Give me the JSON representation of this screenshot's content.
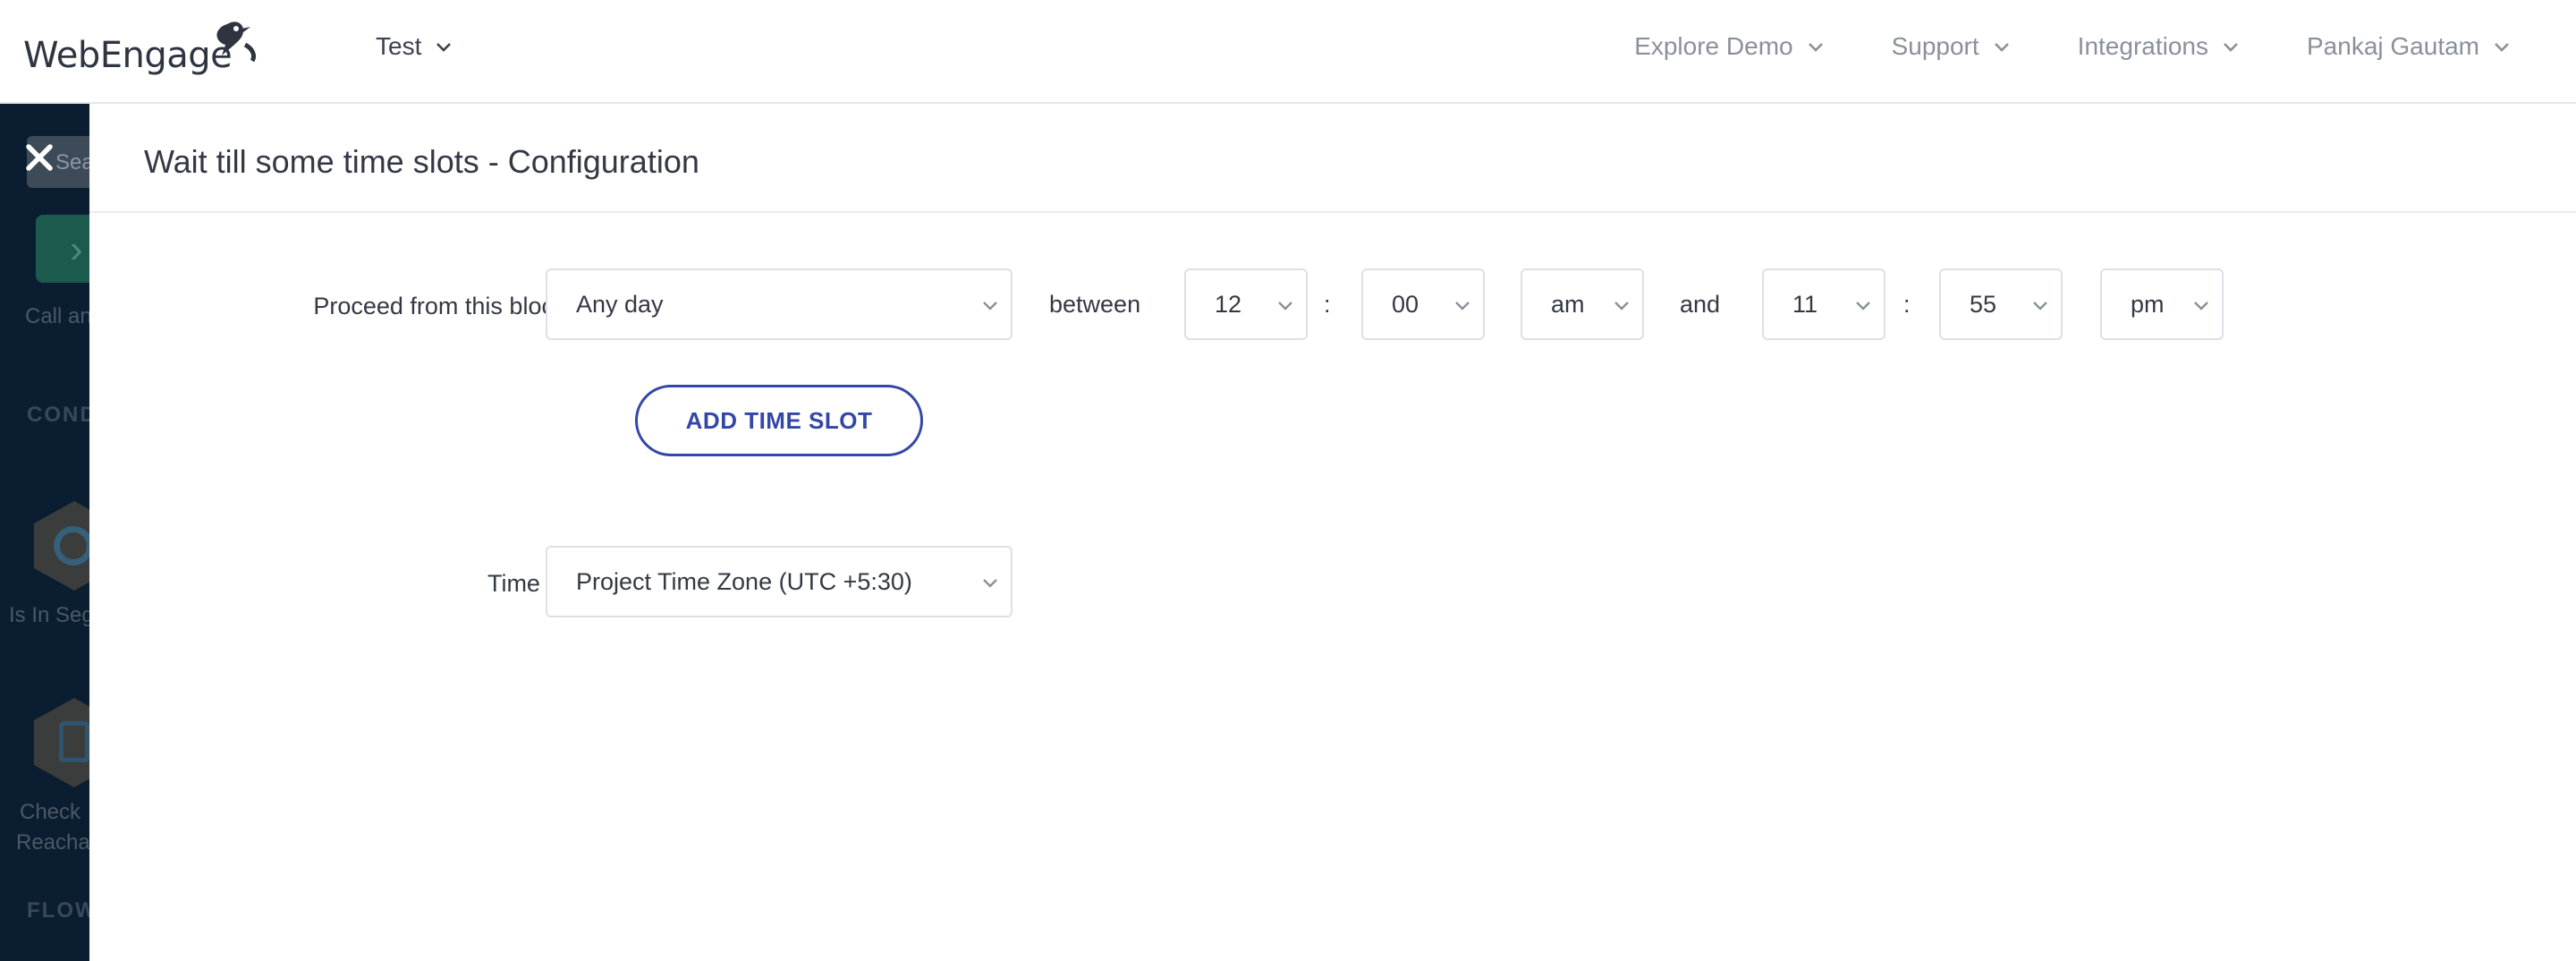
{
  "header": {
    "logo_text": "WebEngage",
    "project": "Test",
    "nav": [
      "Explore Demo",
      "Support",
      "Integrations",
      "Pankaj Gautam"
    ]
  },
  "sidebar": {
    "search_text": "Sear",
    "block_label": "Call an",
    "section_conditions": "COND",
    "item1": "Is In Seg",
    "item2_line1": "Check",
    "item2_line2": "Reacha",
    "section_flow": "FLOW"
  },
  "modal": {
    "title": "Wait till some time slots - Configuration",
    "proceed_label": "Proceed from this block on",
    "day": "Any day",
    "between": "between",
    "start_hour": "12",
    "start_minute": "00",
    "start_ampm": "am",
    "and": "and",
    "end_hour": "11",
    "end_minute": "55",
    "end_ampm": "pm",
    "colon": ":",
    "add_slot": "ADD TIME SLOT",
    "timezone_label": "Time zone",
    "timezone": "Project Time Zone (UTC +5:30)"
  },
  "colors": {
    "accent": "#3347a6",
    "sidebar_bg": "#0b1e31",
    "text": "#333844",
    "nav_text": "#8a909b"
  }
}
